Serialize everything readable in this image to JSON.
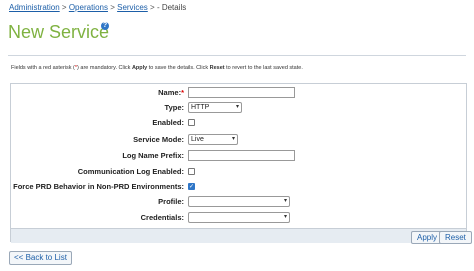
{
  "breadcrumb": {
    "items": [
      "Administration",
      "Operations",
      "Services"
    ],
    "separator": ">",
    "current": "- Details"
  },
  "page": {
    "title": "New Service",
    "help_glyph": "?"
  },
  "note": {
    "before_asterisk": "Fields with a red asterisk (",
    "asterisk": "*",
    "middle1": ") are mandatory. Click ",
    "apply_word": "Apply",
    "middle2": " to save the details. Click ",
    "reset_word": "Reset",
    "after": " to revert to the last saved state."
  },
  "form": {
    "name": {
      "label": "Name:",
      "required_mark": "*",
      "value": ""
    },
    "type": {
      "label": "Type:",
      "value": "HTTP"
    },
    "enabled": {
      "label": "Enabled:",
      "checked": false
    },
    "service_mode": {
      "label": "Service Mode:",
      "value": "Live"
    },
    "log_name_prefix": {
      "label": "Log Name Prefix:",
      "value": ""
    },
    "communication_log_enabled": {
      "label": "Communication Log Enabled:",
      "checked": false
    },
    "force_prd": {
      "label": "Force PRD Behavior in Non-PRD Environments:",
      "checked": true
    },
    "profile": {
      "label": "Profile:",
      "value": ""
    },
    "credentials": {
      "label": "Credentials:",
      "value": ""
    }
  },
  "buttons": {
    "apply": "Apply",
    "reset": "Reset",
    "back": "<< Back to List"
  },
  "icons": {
    "dropdown": "chevron-down-icon",
    "check": "checkmark-icon"
  },
  "colors": {
    "title": "#7fb241",
    "link": "#1d5fa8",
    "required": "#dd0000",
    "checkbox": "#2f76c7"
  }
}
